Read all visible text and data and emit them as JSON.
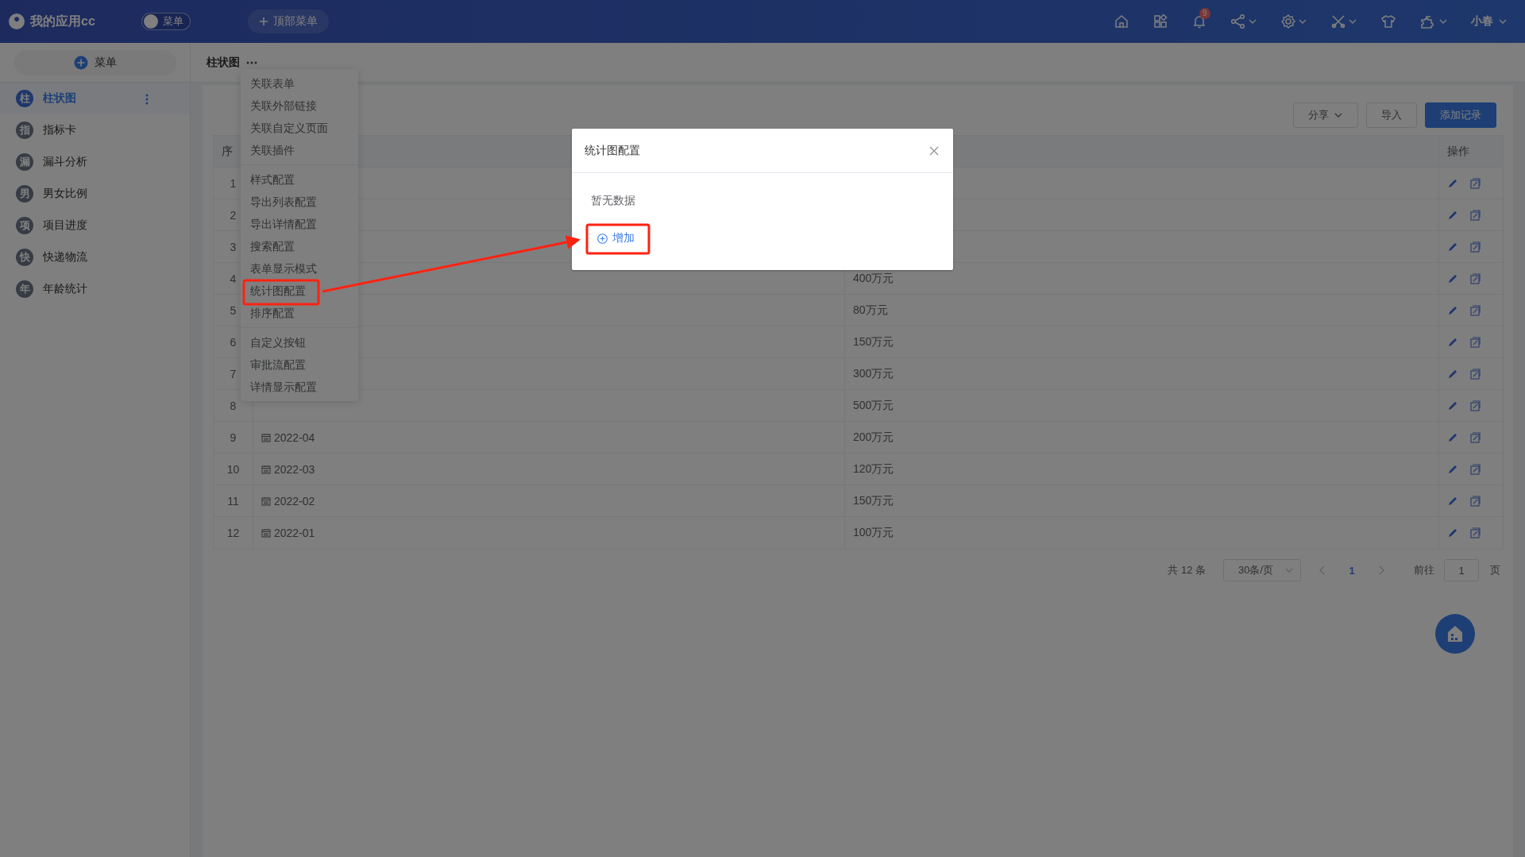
{
  "topbar": {
    "app_name": "我的应用cc",
    "menu_toggle": {
      "label": "菜单",
      "on": false
    },
    "top_menu_button": "顶部菜单",
    "notification_count": "9",
    "user": "小春"
  },
  "sidebar": {
    "add_button": "菜单",
    "items": [
      {
        "avatar": "柱",
        "label": "柱状图",
        "selected": true
      },
      {
        "avatar": "指",
        "label": "指标卡",
        "selected": false
      },
      {
        "avatar": "漏",
        "label": "漏斗分析",
        "selected": false
      },
      {
        "avatar": "男",
        "label": "男女比例",
        "selected": false
      },
      {
        "avatar": "项",
        "label": "项目进度",
        "selected": false
      },
      {
        "avatar": "快",
        "label": "快递物流",
        "selected": false
      },
      {
        "avatar": "年",
        "label": "年龄统计",
        "selected": false
      }
    ]
  },
  "breadcrumb": {
    "title": "柱状图"
  },
  "dropdown_menu": {
    "groups": [
      [
        "关联表单",
        "关联外部链接",
        "关联自定义页面",
        "关联插件"
      ],
      [
        "样式配置",
        "导出列表配置",
        "导出详情配置",
        "搜索配置",
        "表单显示模式",
        "统计图配置",
        "排序配置"
      ],
      [
        "自定义按钮",
        "审批流配置",
        "详情显示配置"
      ]
    ]
  },
  "toolbar": {
    "buttons": [
      {
        "label": "分享",
        "kind": "dropdown"
      },
      {
        "label": "导入",
        "kind": "default"
      },
      {
        "label": "添加记录",
        "kind": "primary"
      }
    ]
  },
  "table": {
    "column_1": "序",
    "column_4": "操作",
    "rows": [
      {
        "seq": "1"
      },
      {
        "seq": "2"
      },
      {
        "seq": "3"
      },
      {
        "seq": "4",
        "amount": "400万元"
      },
      {
        "seq": "5",
        "amount": "80万元"
      },
      {
        "seq": "6",
        "amount": "150万元"
      },
      {
        "seq": "7",
        "amount": "300万元"
      },
      {
        "seq": "8",
        "amount": "500万元"
      },
      {
        "seq": "9",
        "date": "2022-04",
        "amount": "200万元"
      },
      {
        "seq": "10",
        "date": "2022-03",
        "amount": "120万元"
      },
      {
        "seq": "11",
        "date": "2022-02",
        "amount": "150万元"
      },
      {
        "seq": "12",
        "date": "2022-01",
        "amount": "100万元"
      }
    ]
  },
  "pagination": {
    "total": "共 12 条",
    "page_size": "30条/页",
    "pages": [
      {
        "label": "1",
        "selected": true
      }
    ],
    "goto_label": "前往",
    "goto_value": "1",
    "page_suffix": "页"
  },
  "modal": {
    "title": "统计图配置",
    "empty_text": "暂无数据",
    "add_button": "增加"
  }
}
